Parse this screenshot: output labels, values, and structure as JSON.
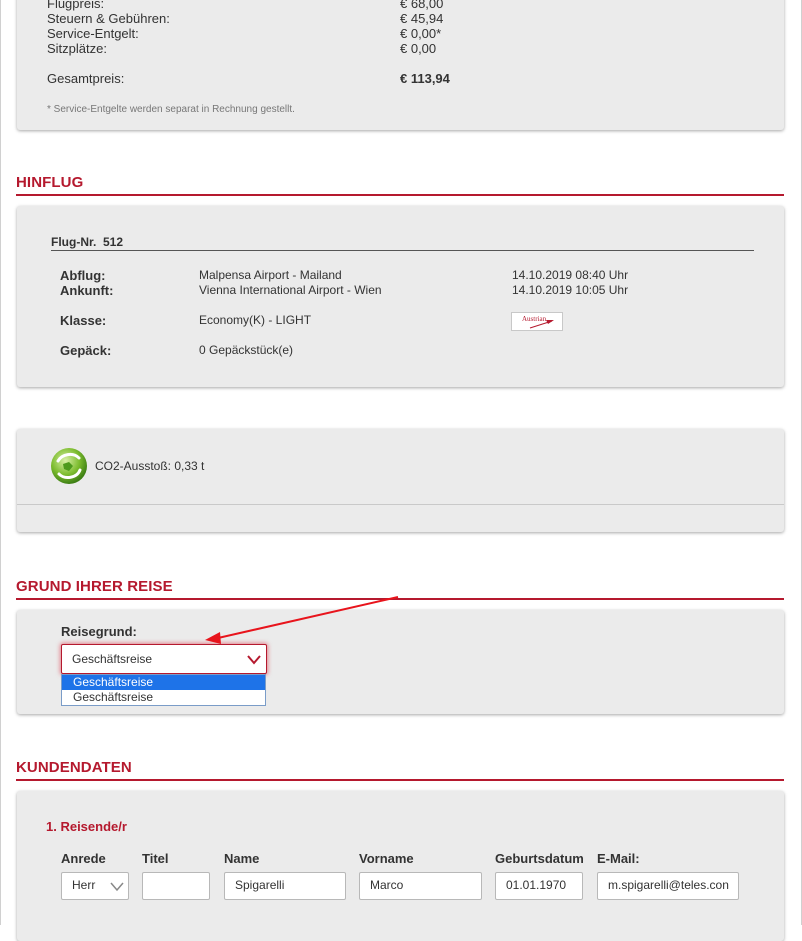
{
  "price_summary": {
    "rows": [
      {
        "label": "Flugpreis:",
        "value": "€ 68,00"
      },
      {
        "label": "Steuern & Gebühren:",
        "value": "€ 45,94"
      },
      {
        "label": "Service-Entgelt:",
        "value": "€ 0,00*"
      },
      {
        "label": "Sitzplätze:",
        "value": "€ 0,00"
      }
    ],
    "total_label": "Gesamtpreis:",
    "total_value": "€ 113,94",
    "footnote": "* Service-Entgelte werden separat in Rechnung gestellt."
  },
  "hinflug": {
    "section_title": "HINFLUG",
    "flight_no": "Flug-Nr.  512",
    "rows": [
      {
        "label": "Abflug:",
        "value": "Malpensa Airport - Mailand",
        "time": "14.10.2019 08:40 Uhr"
      },
      {
        "label": "Ankunft:",
        "value": "Vienna International Airport - Wien",
        "time": "14.10.2019 10:05 Uhr"
      }
    ],
    "class_label": "Klasse:",
    "class_value": "Economy(K) - LIGHT",
    "baggage_label": "Gepäck:",
    "baggage_value": "0 Gepäckstück(e)",
    "airline_logo_text": "Austrian"
  },
  "co2": {
    "text": "CO2-Ausstoß: 0,33 t",
    "icon": "globe-recycle-icon"
  },
  "reason": {
    "section_title": "GRUND IHRER REISE",
    "field_label": "Reisegrund:",
    "selected": "Geschäftsreise",
    "options": [
      "Geschäftsreise",
      "Geschäftsreise"
    ]
  },
  "customer": {
    "section_title": "KUNDENDATEN",
    "traveler_title": "1. Reisende/r",
    "columns": {
      "anrede": "Anrede",
      "titel": "Titel",
      "name": "Name",
      "vorname": "Vorname",
      "geburtsdatum": "Geburtsdatum",
      "email": "E-Mail:"
    },
    "values": {
      "anrede": "Herr",
      "titel": "",
      "name": "Spigarelli",
      "vorname": "Marco",
      "geburtsdatum": "01.01.1970",
      "email": "m.spigarelli@teles.con"
    }
  },
  "colors": {
    "accent": "#b5192e",
    "panel_bg": "#ebebeb",
    "annotation_arrow": "#e8141c",
    "selected_option": "#1e73e8"
  }
}
